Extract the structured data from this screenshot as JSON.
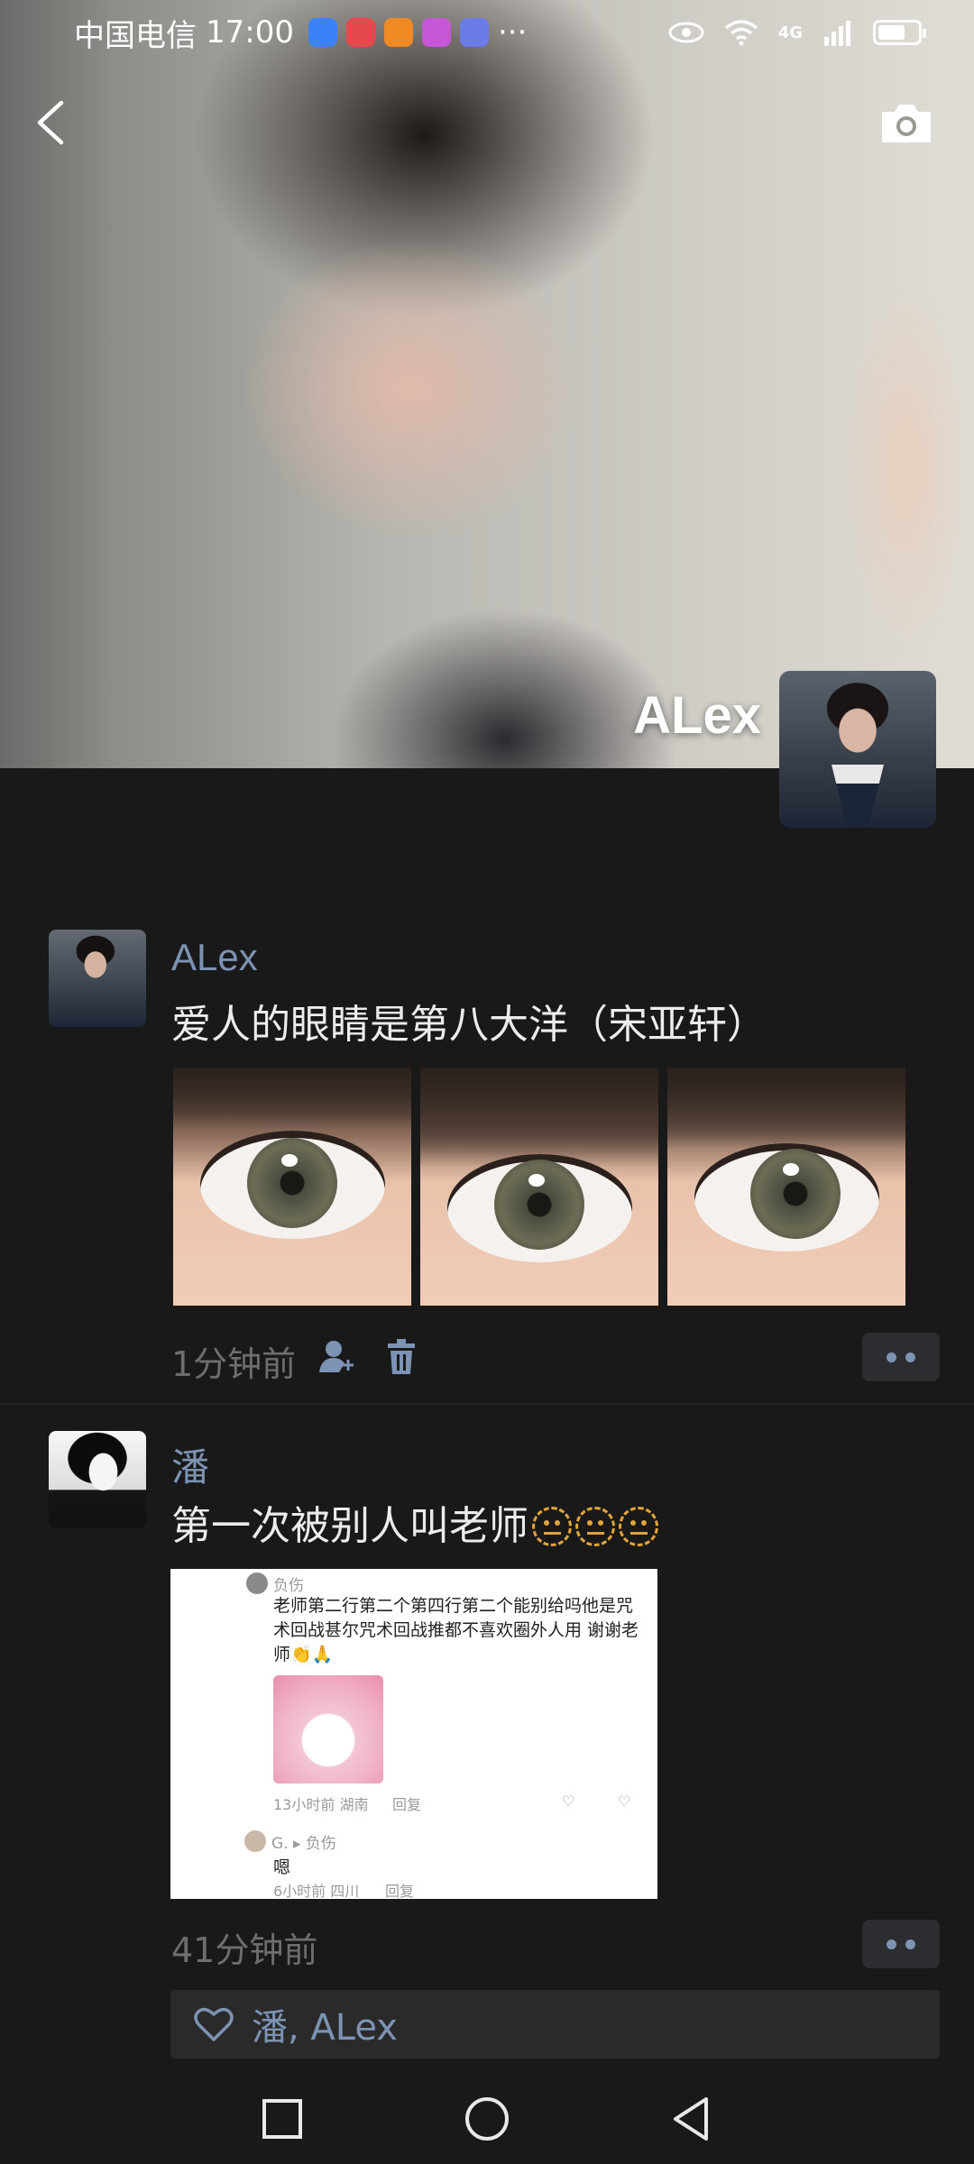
{
  "status_bar": {
    "carrier": "中国电信",
    "time": "17:00",
    "ellipsis": "···",
    "network": "4G",
    "app_colors": [
      "#3b82f6",
      "#e5484d",
      "#f08a24",
      "#c757d8",
      "#6b7be8"
    ]
  },
  "cover": {
    "name": "ALex",
    "back_icon": "back-chevron-icon",
    "camera_icon": "camera-icon"
  },
  "posts": [
    {
      "author": "ALex",
      "text": "爱人的眼睛是第八大洋（宋亚轩）",
      "image_count": 3,
      "time": "1分钟前",
      "icons": [
        "visibility-person-icon",
        "trash-icon"
      ]
    },
    {
      "author": "潘",
      "text": "第一次被别人叫老师",
      "emoji_count": 3,
      "time": "41分钟前",
      "screenshot": {
        "user": "负伤",
        "body": "老师第二行第二个第四行第二个能别给吗他是咒术回战甚尔咒术回战推都不喜欢圈外人用 谢谢老师👏🙏",
        "meta": "13小时前 湖南",
        "reply": "回复",
        "user2": "G. ▸ 负伤",
        "body2": "嗯",
        "meta2": "6小时前 四川",
        "reply2": "回复"
      },
      "likes": "潘, ALex"
    }
  ],
  "colors": {
    "accent_name": "#7d93b4",
    "background": "#191919"
  }
}
